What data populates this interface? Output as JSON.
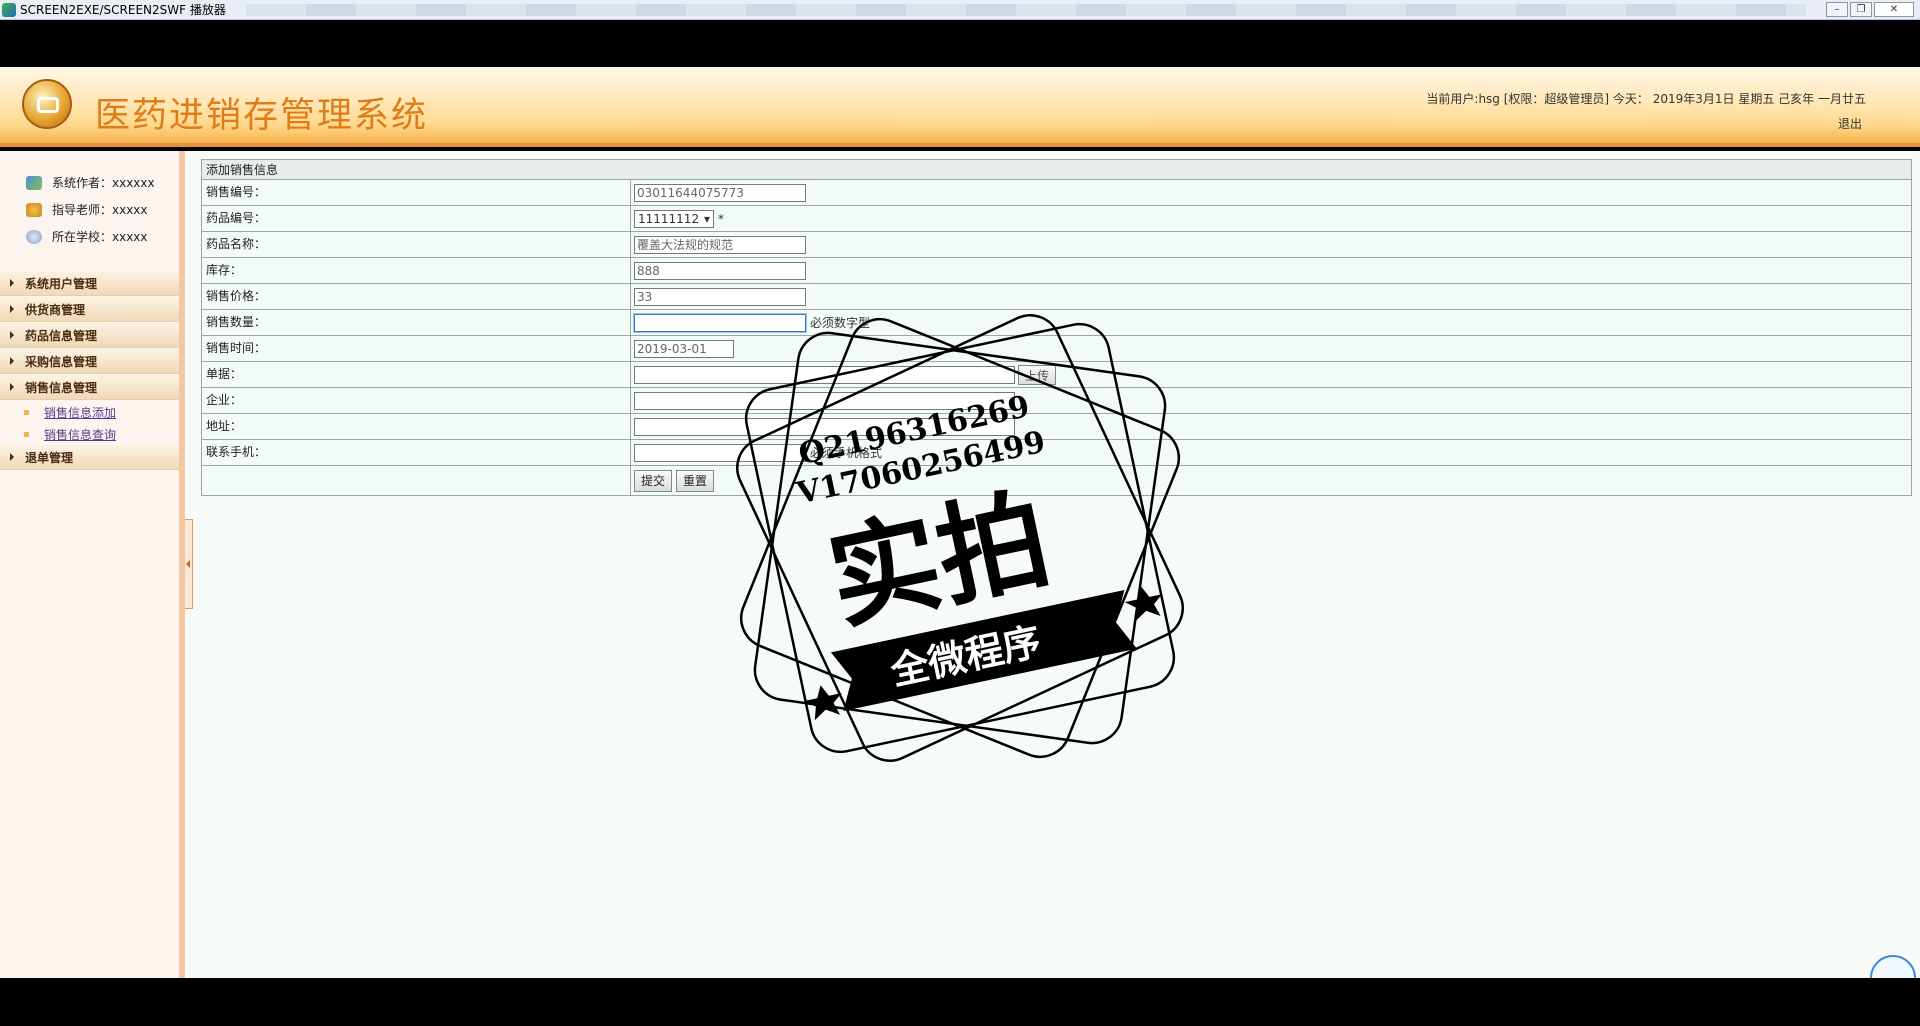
{
  "player": {
    "title": "SCREEN2EXE/SCREEN2SWF 播放器",
    "controls": [
      "–",
      "❐",
      "✕"
    ]
  },
  "header": {
    "system_title": "医药进销存管理系统",
    "user_info": "当前用户:hsg [权限：超级管理员] 今天： 2019年3月1日 星期五 己亥年 一月廿五",
    "logout": "退出"
  },
  "sidebar": {
    "info": [
      {
        "label": "系统作者：xxxxxx",
        "icon": "author-icon"
      },
      {
        "label": "指导老师：xxxxx",
        "icon": "teacher-icon"
      },
      {
        "label": "所在学校：xxxxx",
        "icon": "school-icon"
      }
    ],
    "menu": [
      {
        "label": "系统用户管理"
      },
      {
        "label": "供货商管理"
      },
      {
        "label": "药品信息管理"
      },
      {
        "label": "采购信息管理"
      },
      {
        "label": "销售信息管理"
      },
      {
        "label": "退单管理"
      }
    ],
    "submenu": [
      {
        "label": "销售信息添加"
      },
      {
        "label": "销售信息查询"
      }
    ]
  },
  "form": {
    "caption": "添加销售信息",
    "fields": {
      "sale_no": {
        "label": "销售编号：",
        "value": "03011644075773"
      },
      "drug_no": {
        "label": "药品编号：",
        "value": "11111112",
        "required_mark": "*"
      },
      "drug_name": {
        "label": "药品名称：",
        "value": "覆盖大法规的规范"
      },
      "stock": {
        "label": "库存：",
        "value": "888"
      },
      "price": {
        "label": "销售价格：",
        "value": "33"
      },
      "quantity": {
        "label": "销售数量：",
        "value": "",
        "hint": "必须数字型"
      },
      "sale_time": {
        "label": "销售时间：",
        "value": "2019-03-01"
      },
      "receipt": {
        "label": "单据：",
        "value": "",
        "upload_label": "上传"
      },
      "company": {
        "label": "企业：",
        "value": ""
      },
      "address": {
        "label": "地址：",
        "value": ""
      },
      "phone": {
        "label": "联系手机：",
        "value": "",
        "hint": "必须手机格式"
      }
    },
    "submit_label": "提交",
    "reset_label": "重置"
  },
  "watermark": {
    "line1": "Q2196316269",
    "line2": "V17060256499",
    "main": "实拍",
    "ribbon": "全微程序"
  },
  "colors": {
    "title_orange": "#e07c18",
    "menu_text": "#4a2c10",
    "form_bg": "#f3fbf7",
    "link_purple": "#5a3a8c"
  }
}
